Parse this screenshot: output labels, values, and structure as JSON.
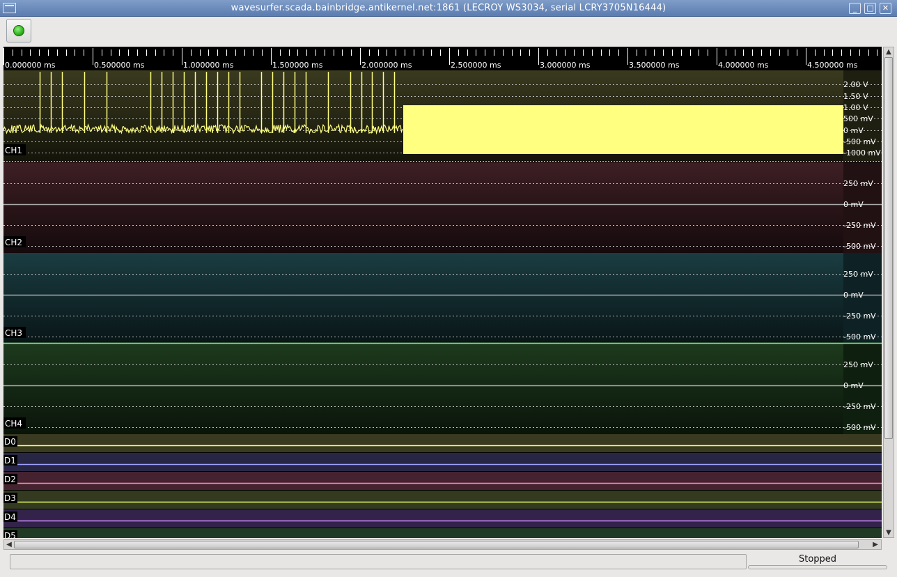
{
  "window": {
    "title": "wavesurfer.scada.bainbridge.antikernel.net:1861 (LECROY WS3034, serial LCRY3705N16444)",
    "minimize_glyph": "_",
    "maximize_glyph": "□",
    "close_glyph": "✕"
  },
  "toolbar": {
    "run_icon": "green-led-icon"
  },
  "timeline": {
    "labels": [
      "0.000000 ms",
      "0.500000 ms",
      "1.000000 ms",
      "1.500000 ms",
      "2.000000 ms",
      "2.500000 ms",
      "3.000000 ms",
      "3.500000 ms",
      "4.000000 ms",
      "4.500000 ms"
    ]
  },
  "analog_channels": [
    {
      "name": "CH1",
      "color": "#ffff80",
      "bg": "#3a3a1f",
      "ticks": [
        "2.00 V",
        "1.50 V",
        "1.00 V",
        "500 mV",
        "0 mV",
        "-500 mV",
        "-1000 mV"
      ]
    },
    {
      "name": "CH2",
      "color": "#ffb0b0",
      "bg": "#3d1f24",
      "ticks": [
        "250 mV",
        "0 mV",
        "-250 mV",
        "-500 mV"
      ]
    },
    {
      "name": "CH3",
      "color": "#80e0ff",
      "bg": "#1a3d42",
      "ticks": [
        "250 mV",
        "0 mV",
        "-250 mV",
        "-500 mV"
      ]
    },
    {
      "name": "CH4",
      "color": "#90ff80",
      "bg": "#1d3a1d",
      "ticks": [
        "250 mV",
        "0 mV",
        "-250 mV",
        "-500 mV"
      ]
    }
  ],
  "digital_channels": [
    {
      "name": "D0",
      "color": "#ffff80",
      "bg": "#3a3a20"
    },
    {
      "name": "D1",
      "color": "#a0a0ff",
      "bg": "#272745"
    },
    {
      "name": "D2",
      "color": "#ff90c0",
      "bg": "#45222f"
    },
    {
      "name": "D3",
      "color": "#e8ff60",
      "bg": "#333a20"
    },
    {
      "name": "D4",
      "color": "#d090ff",
      "bg": "#33224a"
    },
    {
      "name": "D5",
      "color": "#90ffb0",
      "bg": "#213a26"
    }
  ],
  "status": {
    "text": "Stopped"
  }
}
